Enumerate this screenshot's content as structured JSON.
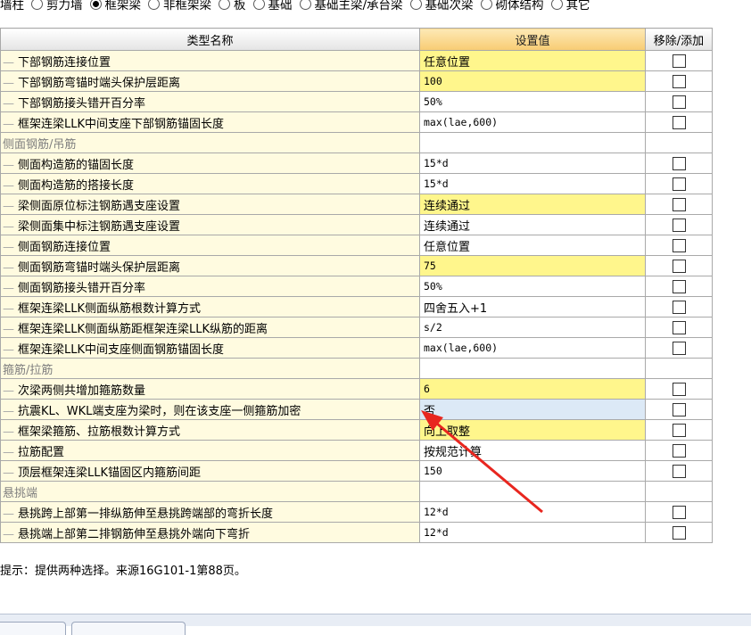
{
  "toolbar": {
    "options": [
      {
        "label": "墙柱",
        "checked": false,
        "has_radio": false
      },
      {
        "label": "剪力墙",
        "checked": false,
        "has_radio": true
      },
      {
        "label": "框架梁",
        "checked": true,
        "has_radio": true
      },
      {
        "label": "非框架梁",
        "checked": false,
        "has_radio": true
      },
      {
        "label": "板",
        "checked": false,
        "has_radio": true
      },
      {
        "label": "基础",
        "checked": false,
        "has_radio": true
      },
      {
        "label": "基础主梁/承台梁",
        "checked": false,
        "has_radio": true
      },
      {
        "label": "基础次梁",
        "checked": false,
        "has_radio": true
      },
      {
        "label": "砌体结构",
        "checked": false,
        "has_radio": true
      },
      {
        "label": "其它",
        "checked": false,
        "has_radio": true
      }
    ]
  },
  "table": {
    "headers": {
      "name": "类型名称",
      "value": "设置值",
      "action": "移除/添加"
    },
    "rows": [
      {
        "name": "下部钢筋连接位置",
        "value": "任意位置",
        "style": "yellow txt",
        "group": false
      },
      {
        "name": "下部钢筋弯锚时端头保护层距离",
        "value": "100",
        "style": "yellow",
        "group": false
      },
      {
        "name": "下部钢筋接头错开百分率",
        "value": "50%",
        "style": "",
        "group": false
      },
      {
        "name": "框架连梁LLK中间支座下部钢筋锚固长度",
        "value": "max(lae,600)",
        "style": "",
        "group": false
      },
      {
        "name": "侧面钢筋/吊筋",
        "value": "",
        "style": "",
        "group": true
      },
      {
        "name": "侧面构造筋的锚固长度",
        "value": "15*d",
        "style": "",
        "group": false
      },
      {
        "name": "侧面构造筋的搭接长度",
        "value": "15*d",
        "style": "",
        "group": false
      },
      {
        "name": "梁侧面原位标注钢筋遇支座设置",
        "value": "连续通过",
        "style": "yellow txt",
        "group": false
      },
      {
        "name": "梁侧面集中标注钢筋遇支座设置",
        "value": "连续通过",
        "style": "txt",
        "group": false
      },
      {
        "name": "侧面钢筋连接位置",
        "value": "任意位置",
        "style": "txt",
        "group": false
      },
      {
        "name": "侧面钢筋弯锚时端头保护层距离",
        "value": "75",
        "style": "yellow",
        "group": false
      },
      {
        "name": "侧面钢筋接头错开百分率",
        "value": "50%",
        "style": "",
        "group": false
      },
      {
        "name": "框架连梁LLK侧面纵筋根数计算方式",
        "value": "四舍五入+1",
        "style": "txt",
        "group": false
      },
      {
        "name": "框架连梁LLK侧面纵筋距框架连梁LLK纵筋的距离",
        "value": "s/2",
        "style": "",
        "group": false
      },
      {
        "name": "框架连梁LLK中间支座侧面钢筋锚固长度",
        "value": "max(lae,600)",
        "style": "",
        "group": false
      },
      {
        "name": "箍筋/拉筋",
        "value": "",
        "style": "",
        "group": true
      },
      {
        "name": "次梁两侧共增加箍筋数量",
        "value": "6",
        "style": "yellow",
        "group": false
      },
      {
        "name": "抗震KL、WKL端支座为梁时，则在该支座一侧箍筋加密",
        "value": "否",
        "style": "sel txt",
        "group": false
      },
      {
        "name": "框架梁箍筋、拉筋根数计算方式",
        "value": "向上取整",
        "style": "yellow txt",
        "group": false
      },
      {
        "name": "拉筋配置",
        "value": "按规范计算",
        "style": "txt",
        "group": false
      },
      {
        "name": "顶层框架连梁LLK锚固区内箍筋间距",
        "value": "150",
        "style": "",
        "group": false
      },
      {
        "name": "悬挑端",
        "value": "",
        "style": "",
        "group": true
      },
      {
        "name": "悬挑跨上部第一排纵筋伸至悬挑跨端部的弯折长度",
        "value": "12*d",
        "style": "",
        "group": false
      },
      {
        "name": "悬挑端上部第二排钢筋伸至悬挑外端向下弯折",
        "value": "12*d",
        "style": "",
        "group": false
      }
    ]
  },
  "hint": "提示：提供两种选择。来源16G101-1第88页。",
  "colors": {
    "annotation_arrow": "#e8261f",
    "value_header": "#f8cc73",
    "highlight": "#fff68c",
    "name_bg": "#fffbe0"
  }
}
